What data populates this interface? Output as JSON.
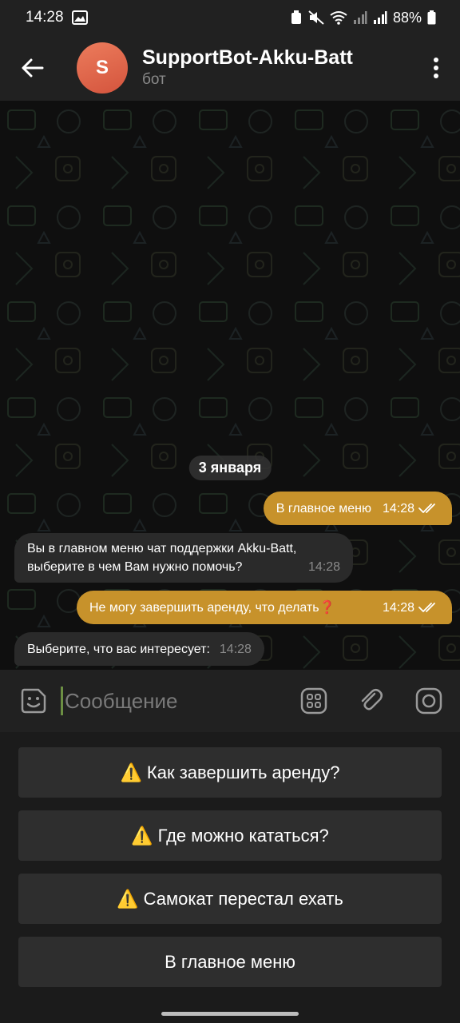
{
  "status": {
    "time": "14:28",
    "battery": "88%"
  },
  "header": {
    "avatar_letter": "S",
    "title": "SupportBot-Akku-Batt",
    "subtitle": "бот"
  },
  "chat": {
    "date": "3 января",
    "messages": [
      {
        "dir": "out",
        "text": "В главное меню",
        "time": "14:28"
      },
      {
        "dir": "in",
        "text": "Вы в главном меню чат поддержки Akku-Batt, выберите в чем Вам нужно помочь?",
        "time": "14:28"
      },
      {
        "dir": "out",
        "text": "Не могу завершить аренду, что делать❓",
        "time": "14:28"
      },
      {
        "dir": "in",
        "text": "Выберите, что вас интересует:",
        "time": "14:28"
      }
    ]
  },
  "input": {
    "placeholder": "Сообщение"
  },
  "keyboard": {
    "buttons": [
      {
        "icon": "⚠️",
        "label": "Как завершить аренду?"
      },
      {
        "icon": "⚠️",
        "label": "Где можно кататься?"
      },
      {
        "icon": "⚠️",
        "label": "Самокат перестал ехать"
      },
      {
        "icon": "",
        "label": "В главное меню"
      }
    ]
  },
  "colors": {
    "outgoing": "#c7922b",
    "incoming": "#2a2a2a",
    "avatar": "#e0654a"
  }
}
